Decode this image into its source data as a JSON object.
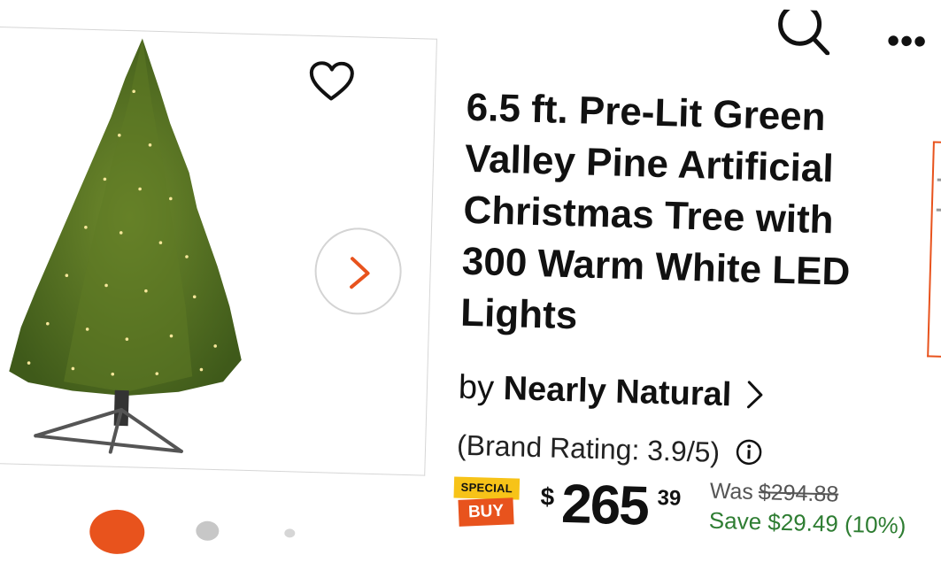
{
  "header": {
    "search_icon": "search-icon",
    "more_label": "•••"
  },
  "gallery": {
    "favorite_icon": "heart-icon",
    "next_icon": "chevron-right-icon",
    "dot_count": 3,
    "active_dot": 0
  },
  "product": {
    "title_lines": [
      "6.5 ft. Pre-Lit Green",
      "Valley Pine Artificial",
      "Christmas Tree with",
      "300 Warm White LED",
      "Lights"
    ],
    "brand_prefix": "by",
    "brand_name": "Nearly Natural",
    "brand_rating": "(Brand Rating: 3.9/5)"
  },
  "badge": {
    "top": "SPECIAL",
    "bottom": "BUY"
  },
  "pricing": {
    "currency": "$",
    "dollars": "265",
    "cents": "39",
    "was_label": "Was",
    "was_price": "$294.88",
    "savings": "Save $29.49 (10%)"
  },
  "colors": {
    "accent": "#e8531d",
    "savings": "#2e7d32",
    "badge_yellow": "#f7c318"
  }
}
